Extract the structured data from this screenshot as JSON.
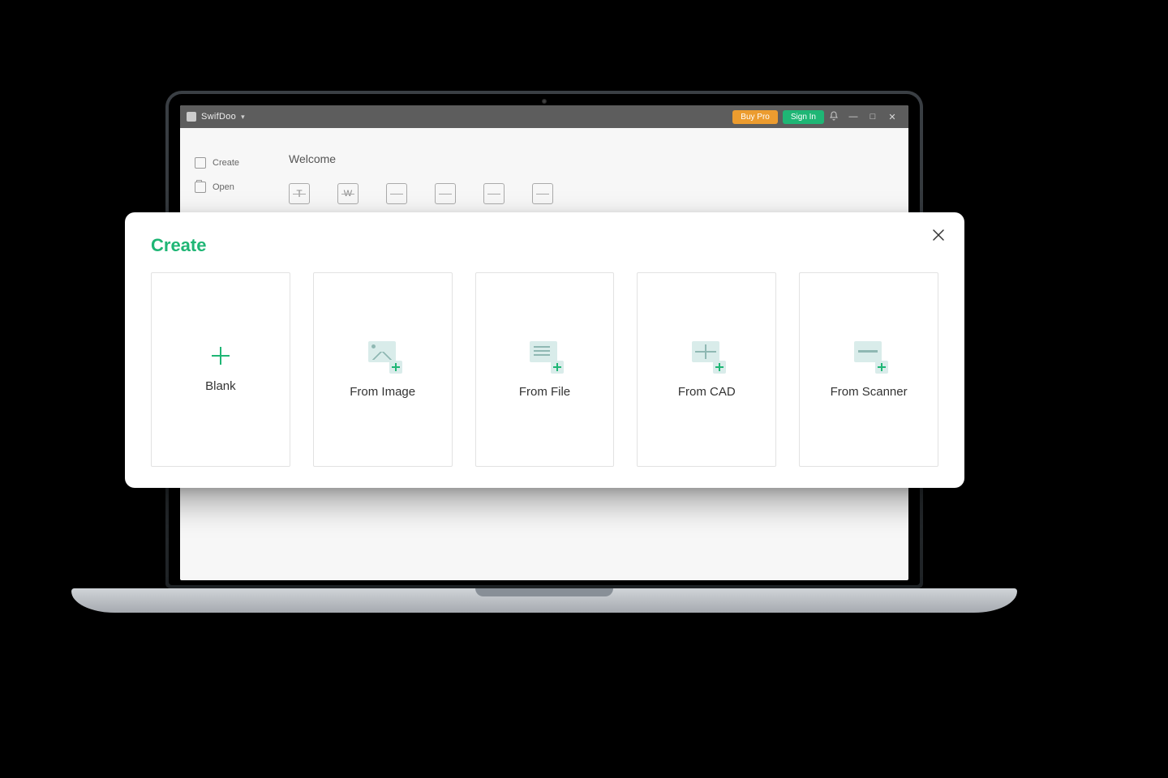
{
  "app": {
    "name": "SwifDoo",
    "buy_label": "Buy Pro",
    "signin_label": "Sign In"
  },
  "sidebar": {
    "items": [
      {
        "label": "Create"
      },
      {
        "label": "Open"
      }
    ]
  },
  "main": {
    "welcome": "Welcome"
  },
  "modal": {
    "title": "Create",
    "cards": [
      {
        "label": "Blank"
      },
      {
        "label": "From Image"
      },
      {
        "label": "From File"
      },
      {
        "label": "From CAD"
      },
      {
        "label": "From Scanner"
      }
    ]
  },
  "colors": {
    "accent": "#1fb675",
    "buy": "#ec9c2f"
  }
}
